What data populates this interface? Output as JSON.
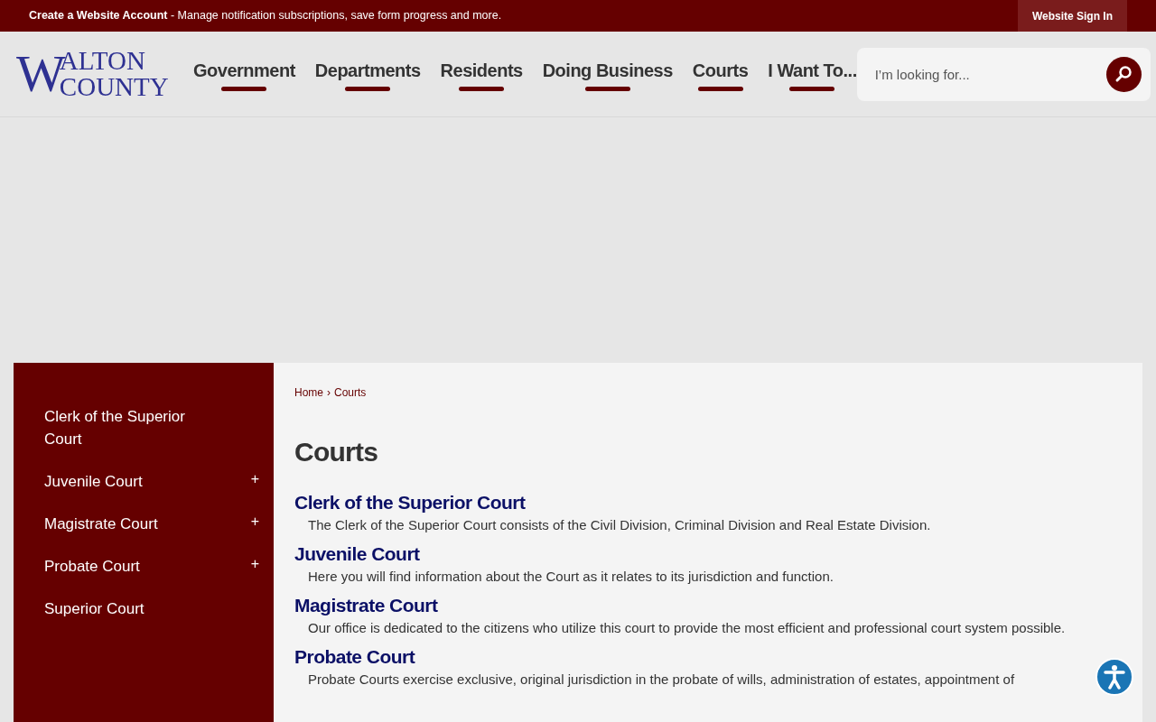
{
  "top_bar": {
    "message": "**Create a Website Account** - Manage notification subscriptions, save form progress and more.",
    "sign_in": "Website Sign In"
  },
  "logo": {
    "initial": "W",
    "line_1": "ALTON",
    "line_2": "COUNTY"
  },
  "nav": [
    {
      "label": "Government"
    },
    {
      "label": "Departments"
    },
    {
      "label": "Residents"
    },
    {
      "label": "Doing Business"
    },
    {
      "label": "Courts"
    },
    {
      "label": "I Want To..."
    }
  ],
  "search": {
    "placeholder": "I’m looking for..."
  },
  "sidebar": {
    "items": [
      {
        "label": "Clerk of the Superior Court"
      },
      {
        "label": "Juvenile Court",
        "toggle": "+"
      },
      {
        "label": "Magistrate Court",
        "toggle": "+"
      },
      {
        "label": "Probate Court",
        "toggle": "+"
      },
      {
        "label": "Superior Court"
      }
    ]
  },
  "breadcrumb": [
    "Home",
    "Courts"
  ],
  "breadcrumb_separator": "›",
  "page_title": "Courts",
  "entries": [
    {
      "title": "Clerk of the Superior Court",
      "description": "The Clerk of the Superior Court consists of the Civil Division, Criminal Division and Real Estate Division."
    },
    {
      "title": "Juvenile Court",
      "description": "Here you will find information about the Court as it relates to its jurisdiction and function."
    },
    {
      "title": "Magistrate Court",
      "description": "Our office is dedicated to the citizens who utilize this court to provide the most efficient and professional court system possible."
    },
    {
      "title": "Probate Court",
      "description": "Probate Courts exercise exclusive, original jurisdiction in the probate of wills, administration of estates, appointment of"
    }
  ]
}
